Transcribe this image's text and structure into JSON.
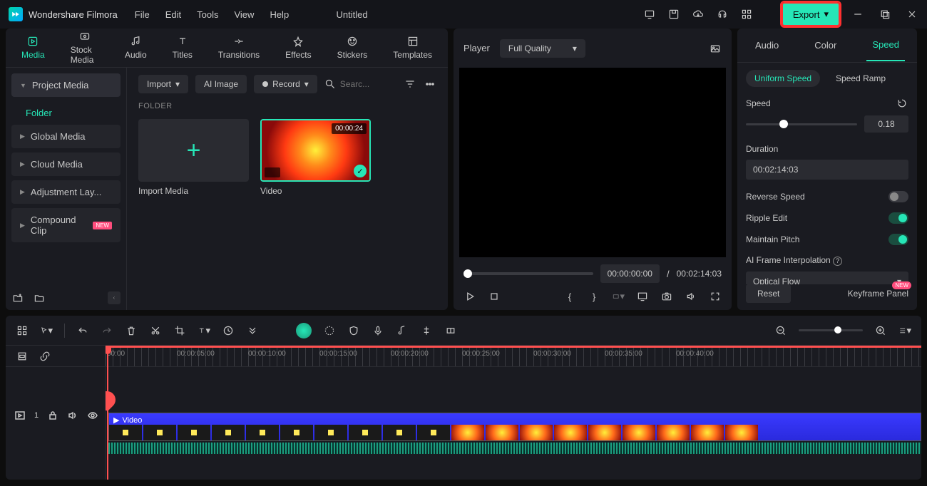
{
  "app": {
    "name": "Wondershare Filmora",
    "doc": "Untitled"
  },
  "menu": {
    "file": "File",
    "edit": "Edit",
    "tools": "Tools",
    "view": "View",
    "help": "Help"
  },
  "export_label": "Export",
  "media_tabs": {
    "media": "Media",
    "stock": "Stock Media",
    "audio": "Audio",
    "titles": "Titles",
    "transitions": "Transitions",
    "effects": "Effects",
    "stickers": "Stickers",
    "templates": "Templates"
  },
  "media_sidebar": {
    "project": "Project Media",
    "folder": "Folder",
    "global": "Global Media",
    "cloud": "Cloud Media",
    "adjustment": "Adjustment Lay...",
    "compound": "Compound Clip",
    "new": "NEW"
  },
  "media_toolbar": {
    "import": "Import",
    "ai_image": "AI Image",
    "record": "Record",
    "search_ph": "Searc..."
  },
  "folder_label": "FOLDER",
  "thumbs": {
    "import_media": "Import Media",
    "video": "Video",
    "video_dur": "00:00:24"
  },
  "preview": {
    "player": "Player",
    "quality": "Full Quality",
    "time_current": "00:00:00:00",
    "time_sep": "/",
    "time_total": "00:02:14:03"
  },
  "props": {
    "tabs": {
      "audio": "Audio",
      "color": "Color",
      "speed": "Speed"
    },
    "chips": {
      "uniform": "Uniform Speed",
      "ramp": "Speed Ramp"
    },
    "speed_label": "Speed",
    "speed_val": "0.18",
    "duration_label": "Duration",
    "duration_val": "00:02:14:03",
    "reverse": "Reverse Speed",
    "ripple": "Ripple Edit",
    "maintain": "Maintain Pitch",
    "ai_frame": "AI Frame Interpolation",
    "optical": "Optical Flow",
    "reset": "Reset",
    "keyframe": "Keyframe Panel",
    "new": "NEW"
  },
  "timeline": {
    "ticks": [
      "00:00",
      "00:00:05:00",
      "00:00:10:00",
      "00:00:15:00",
      "00:00:20:00",
      "00:00:25:00",
      "00:00:30:00",
      "00:00:35:00",
      "00:00:40:00"
    ],
    "track_num": "1",
    "clip_label": "Video"
  }
}
